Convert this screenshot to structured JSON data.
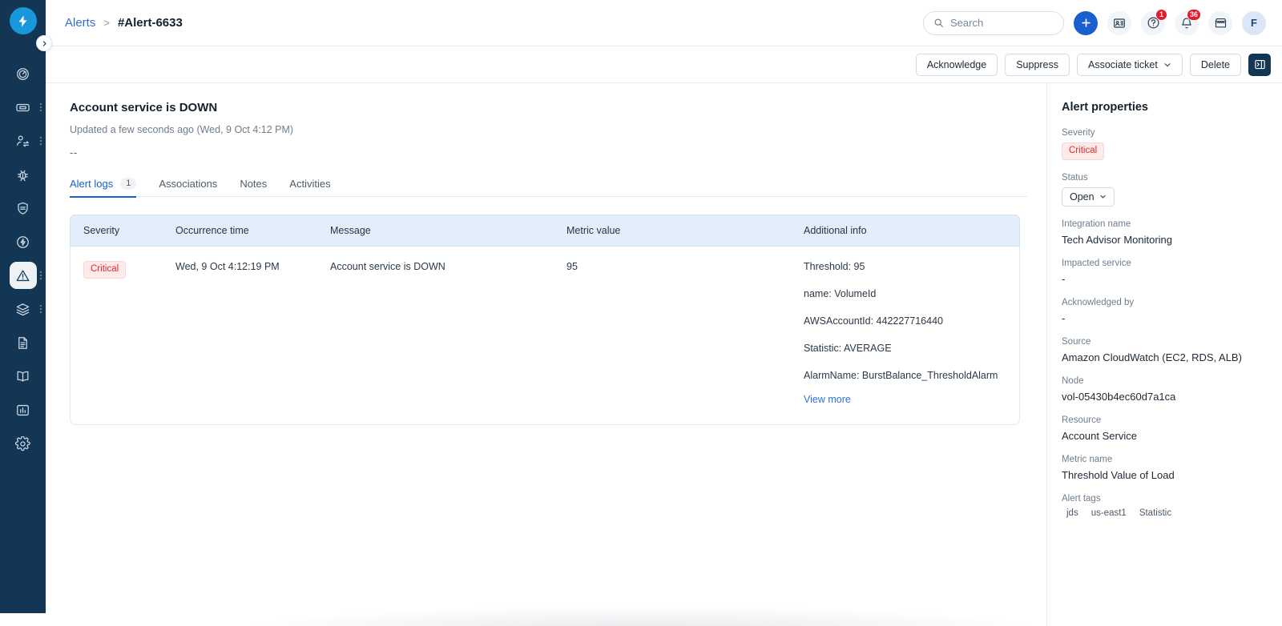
{
  "colors": {
    "rail_bg": "#123653",
    "logo_bg": "#1898da",
    "primary": "#1a5fd0",
    "link": "#2f6fdb",
    "critical_text": "#e02b2b",
    "critical_bg": "#fdeaea",
    "table_header_bg": "#e2effb",
    "badge_red": "#e8192c"
  },
  "sidebar": {
    "logo_icon": "lightning-bolt-icon",
    "toggle_icon": "chevron-right-icon",
    "items": [
      {
        "name": "dashboard",
        "icon": "gauge-icon",
        "active": false,
        "has_dots": false
      },
      {
        "name": "tickets",
        "icon": "ticket-icon",
        "active": false,
        "has_dots": true
      },
      {
        "name": "on-call",
        "icon": "user-switch-icon",
        "active": false,
        "has_dots": true
      },
      {
        "name": "bugs",
        "icon": "bug-icon",
        "active": false,
        "has_dots": false
      },
      {
        "name": "status",
        "icon": "shield-icon",
        "active": false,
        "has_dots": false
      },
      {
        "name": "automation",
        "icon": "bolt-circle-icon",
        "active": false,
        "has_dots": false
      },
      {
        "name": "alerts",
        "icon": "alert-triangle-icon",
        "active": true,
        "has_dots": true
      },
      {
        "name": "services",
        "icon": "layers-icon",
        "active": false,
        "has_dots": true
      },
      {
        "name": "reports",
        "icon": "document-icon",
        "active": false,
        "has_dots": false
      },
      {
        "name": "knowledge-base",
        "icon": "book-icon",
        "active": false,
        "has_dots": false
      },
      {
        "name": "analytics",
        "icon": "bar-chart-icon",
        "active": false,
        "has_dots": false
      },
      {
        "name": "settings",
        "icon": "gear-icon",
        "active": false,
        "has_dots": false
      }
    ]
  },
  "topbar": {
    "breadcrumb_root": "Alerts",
    "breadcrumb_separator": ">",
    "breadcrumb_current": "#Alert-6633",
    "search_placeholder": "Search",
    "search_value": "",
    "search_icon": "search-icon",
    "add_icon": "plus-icon",
    "contacts_icon": "contact-card-icon",
    "help_icon": "help-circle-icon",
    "help_badge": "1",
    "notifications_icon": "bell-icon",
    "notifications_badge": "36",
    "marketplace_icon": "store-icon",
    "avatar_initial": "F"
  },
  "actionbar": {
    "acknowledge_label": "Acknowledge",
    "suppress_label": "Suppress",
    "associate_ticket_label": "Associate ticket",
    "associate_ticket_caret": "chevron-down-icon",
    "delete_label": "Delete",
    "panel_toggle_icon": "panel-right-icon"
  },
  "alert": {
    "title": "Account service is DOWN",
    "updated": "Updated a few seconds ago (Wed, 9 Oct 4:12 PM)",
    "description": "--"
  },
  "tabs": [
    {
      "label": "Alert logs",
      "count": "1",
      "active": true
    },
    {
      "label": "Associations",
      "count": null,
      "active": false
    },
    {
      "label": "Notes",
      "count": null,
      "active": false
    },
    {
      "label": "Activities",
      "count": null,
      "active": false
    }
  ],
  "table": {
    "columns": [
      "Severity",
      "Occurrence time",
      "Message",
      "Metric value",
      "Additional info"
    ],
    "rows": [
      {
        "severity": "Critical",
        "occurrence_time": "Wed, 9 Oct 4:12:19 PM",
        "message": "Account service is DOWN",
        "metric_value": "95",
        "additional_info": [
          "Threshold: 95",
          "name: VolumeId",
          "AWSAccountId: 442227716440",
          "Statistic: AVERAGE",
          "AlarmName: BurstBalance_ThresholdAlarm"
        ],
        "view_more_label": "View more"
      }
    ]
  },
  "properties": {
    "heading": "Alert properties",
    "severity_label": "Severity",
    "severity_value": "Critical",
    "status_label": "Status",
    "status_value": "Open",
    "status_caret": "chevron-down-icon",
    "fields": [
      {
        "label": "Integration name",
        "value": "Tech Advisor Monitoring"
      },
      {
        "label": "Impacted service",
        "value": "-"
      },
      {
        "label": "Acknowledged by",
        "value": "-"
      },
      {
        "label": "Source",
        "value": "Amazon CloudWatch (EC2, RDS, ALB)"
      },
      {
        "label": "Node",
        "value": "vol-05430b4ec60d7a1ca"
      },
      {
        "label": "Resource",
        "value": "Account Service"
      },
      {
        "label": "Metric name",
        "value": "Threshold Value of Load"
      }
    ],
    "tags_label": "Alert tags",
    "tags": [
      "jds",
      "us-east1",
      "Statistic"
    ]
  }
}
